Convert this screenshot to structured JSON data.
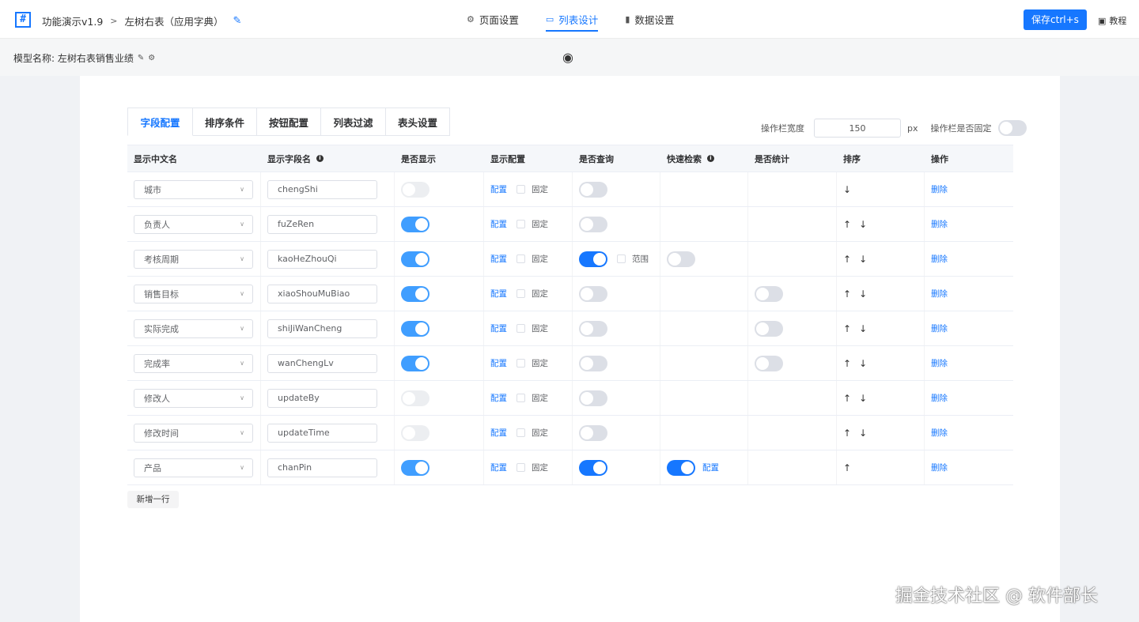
{
  "header": {
    "logo_glyph": "#",
    "breadcrumb": [
      "功能演示v1.9",
      "左树右表（应用字典）"
    ],
    "nav": [
      {
        "label": "页面设置",
        "icon": "gear-icon",
        "active": false
      },
      {
        "label": "列表设计",
        "icon": "monitor-icon",
        "active": true
      },
      {
        "label": "数据设置",
        "icon": "bar-chart-icon",
        "active": false
      }
    ],
    "save_label": "保存ctrl+s",
    "tutorial_label": "教程"
  },
  "model": {
    "label": "模型名称: 左树右表销售业绩"
  },
  "tabs": [
    "字段配置",
    "排序条件",
    "按钮配置",
    "列表过滤",
    "表头设置"
  ],
  "op_width": {
    "label": "操作栏宽度",
    "value": "150",
    "unit": "px",
    "fixed_label": "操作栏是否固定",
    "fixed": false
  },
  "table": {
    "columns": [
      "显示中文名",
      "显示字段名",
      "是否显示",
      "显示配置",
      "是否查询",
      "快速检索",
      "是否统计",
      "排序",
      "操作"
    ],
    "config_label": "配置",
    "fixed_label": "固定",
    "range_label": "范围",
    "delete_label": "删除",
    "rows": [
      {
        "cn": "城市",
        "field": "chengShi",
        "show": "disabled",
        "query": false,
        "quick": null,
        "range": false,
        "stat": null,
        "up": false,
        "down": true
      },
      {
        "cn": "负责人",
        "field": "fuZeRen",
        "show": "on",
        "query": false,
        "quick": null,
        "range": false,
        "stat": null,
        "up": true,
        "down": true
      },
      {
        "cn": "考核周期",
        "field": "kaoHeZhouQi",
        "show": "on",
        "query": true,
        "quick": false,
        "range": true,
        "stat": null,
        "up": true,
        "down": true
      },
      {
        "cn": "销售目标",
        "field": "xiaoShouMuBiao",
        "show": "on",
        "query": false,
        "quick": null,
        "range": false,
        "stat": false,
        "up": true,
        "down": true
      },
      {
        "cn": "实际完成",
        "field": "shiJiWanCheng",
        "show": "on",
        "query": false,
        "quick": null,
        "range": false,
        "stat": false,
        "up": true,
        "down": true
      },
      {
        "cn": "完成率",
        "field": "wanChengLv",
        "show": "on",
        "query": false,
        "quick": null,
        "range": false,
        "stat": false,
        "up": true,
        "down": true
      },
      {
        "cn": "修改人",
        "field": "updateBy",
        "show": "disabled",
        "query": false,
        "quick": null,
        "range": false,
        "stat": null,
        "up": true,
        "down": true
      },
      {
        "cn": "修改时间",
        "field": "updateTime",
        "show": "disabled",
        "query": false,
        "quick": null,
        "range": false,
        "stat": null,
        "up": true,
        "down": true
      },
      {
        "cn": "产品",
        "field": "chanPin",
        "show": "on",
        "query": true,
        "quick": true,
        "quick_config": true,
        "range": false,
        "stat": null,
        "up": true,
        "down": false
      }
    ]
  },
  "add_row_label": "新增一行",
  "watermark": "掘金技术社区 @ 软件部长"
}
